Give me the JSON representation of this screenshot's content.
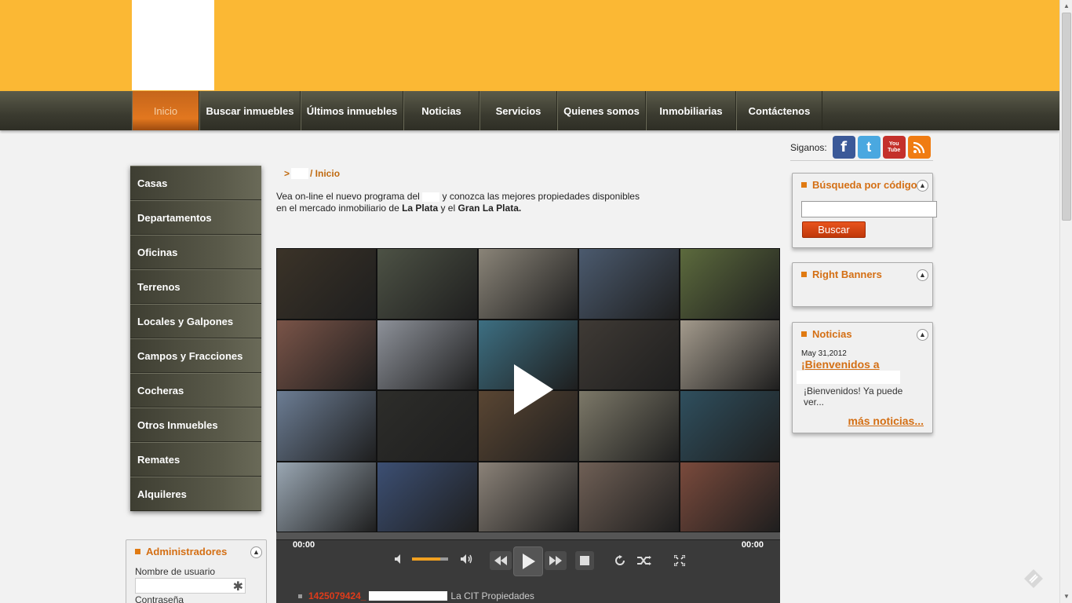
{
  "nav": {
    "items": [
      {
        "label": "Inicio",
        "active": true
      },
      {
        "label": "Buscar inmuebles"
      },
      {
        "label": "Últimos inmuebles"
      },
      {
        "label": "Noticias"
      },
      {
        "label": "Servicios"
      },
      {
        "label": "Quienes somos"
      },
      {
        "label": "Inmobiliarias"
      },
      {
        "label": "Contáctenos"
      }
    ]
  },
  "sidebar": {
    "items": [
      {
        "label": "Casas"
      },
      {
        "label": "Departamentos"
      },
      {
        "label": "Oficinas"
      },
      {
        "label": "Terrenos"
      },
      {
        "label": "Locales y Galpones"
      },
      {
        "label": "Campos y Fracciones"
      },
      {
        "label": "Cocheras"
      },
      {
        "label": "Otros Inmuebles"
      },
      {
        "label": "Remates"
      },
      {
        "label": "Alquileres"
      }
    ],
    "admin": {
      "title": "Administradores",
      "username_label": "Nombre de usuario",
      "password_label": "Contraseña"
    }
  },
  "breadcrumb": {
    "prefix": ">",
    "current": "/ Inicio"
  },
  "intro": {
    "line1_a": "Vea on-line el nuevo programa del",
    "line1_b": "y conozca las mejores propiedades disponibles",
    "line2_a": "en el mercado inmobiliario de",
    "city1": "La Plata",
    "line2_b": "y el",
    "city2": "Gran La Plata."
  },
  "player": {
    "time_current": "00:00",
    "time_total": "00:00",
    "volume": 0.78,
    "tile_colors": [
      "#3b3328",
      "#4d5245",
      "#8a8478",
      "#4b5a6e",
      "#5c6a3d",
      "#7a5448",
      "#8d9199",
      "#3d6f82",
      "#3f3a35",
      "#a39a8c",
      "#6c7d94",
      "#2d2d2a",
      "#5a4633",
      "#7c7868",
      "#2f4f5e",
      "#9aa7b3",
      "#3c4f73",
      "#8b8278",
      "#6f5f55",
      "#7a4a3c"
    ]
  },
  "listing": {
    "code": "1425079424_",
    "text": "La CIT Propiedades"
  },
  "right": {
    "follow_label": "Siganos:",
    "social": [
      {
        "icon": "facebook-icon",
        "glyph": "f",
        "color": "#3b5998"
      },
      {
        "icon": "twitter-icon",
        "glyph": "t",
        "color": "#4aa8e0"
      },
      {
        "icon": "youtube-icon",
        "glyph": "You Tube",
        "color": "#c4302b"
      },
      {
        "icon": "rss-icon",
        "glyph": "◉",
        "color": "#f07c12"
      }
    ],
    "code_search": {
      "title": "Búsqueda por código",
      "button": "Buscar"
    },
    "banners": {
      "title": "Right Banners"
    },
    "news": {
      "title": "Noticias",
      "date": "May 31,2012",
      "headline": "¡Bienvenidos a",
      "body": "¡Bienvenidos! Ya puede ver...",
      "more": "más noticias..."
    }
  }
}
